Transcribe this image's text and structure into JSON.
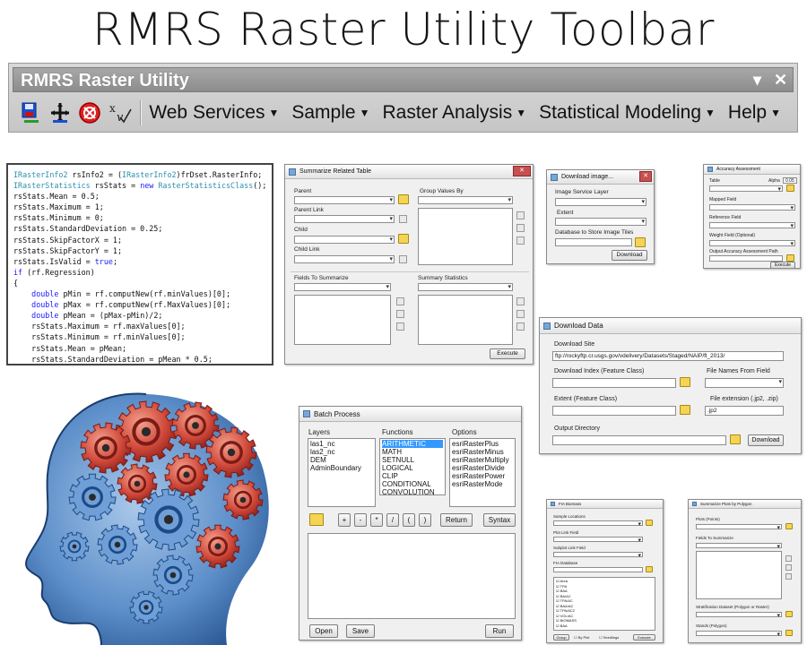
{
  "slide": {
    "title": "RMRS Raster Utility Toolbar"
  },
  "toolbar": {
    "title": "RMRS Raster Utility",
    "controls": {
      "dropdown": "▾",
      "close": "✕"
    },
    "icons": [
      "save-raster-icon",
      "add-data-icon",
      "target-icon",
      "function-icon"
    ],
    "menus": [
      {
        "label": "Web Services"
      },
      {
        "label": "Sample"
      },
      {
        "label": "Raster Analysis"
      },
      {
        "label": "Statistical Modeling"
      },
      {
        "label": "Help"
      }
    ]
  },
  "code": {
    "lines": [
      "IRasterInfo2 rsInfo2 = (IRasterInfo2)frDset.RasterInfo;",
      "IRasterStatistics rsStats = new RasterStatisticsClass();",
      "rsStats.Mean = 0.5;",
      "rsStats.Maximum = 1;",
      "rsStats.Minimum = 0;",
      "rsStats.StandardDeviation = 0.25;",
      "rsStats.SkipFactorX = 1;",
      "rsStats.SkipFactorY = 1;",
      "rsStats.IsValid = true;",
      "if (rf.Regression)",
      "{",
      "    double pMin = rf.computNew(rf.minValues)[0];",
      "    double pMax = rf.computNew(rf.MaxValues)[0];",
      "    double pMean = (pMax-pMin)/2;",
      "    rsStats.Maximum = rf.maxValues[0];",
      "    rsStats.Minimum = rf.minValues[0];",
      "    rsStats.Mean = pMean;",
      "    rsStats.StandardDeviation = pMean * 0.5;",
      "}"
    ]
  },
  "summarize": {
    "title": "Summarize Related Table",
    "parent": "Parent",
    "parent_link": "Parent Link",
    "child": "Child",
    "child_link": "Child Link",
    "group_values_by": "Group Values By",
    "fields_to_summarize": "Fields To Summarize",
    "summary_statistics": "Summary Statistics",
    "execute": "Execute"
  },
  "download_image": {
    "title": "Download image...",
    "image_service_layer": "Image Service Layer",
    "extent": "Extent",
    "database": "Database to Store Image Tiles",
    "download": "Download"
  },
  "accuracy": {
    "title": "Accuracy Assessment",
    "table": "Table",
    "alpha": "Alpha",
    "alpha_value": "0.05",
    "mapped_field": "Mapped Field",
    "reference_field": "Reference Field",
    "weight_field": "Weight Field (Optional)",
    "output_path": "Output Accuracy Assessment Path",
    "execute": "Execute"
  },
  "download_data": {
    "title": "Download Data",
    "download_site": "Download Site",
    "site_url": "ftp://rockyftp.cr.usgs.gov/vdelivery/Datasets/Staged/NAIP/fl_2013/",
    "download_index": "Download Index (Feature Class)",
    "file_names_from_field": "File Names From Field",
    "extent": "Extent (Feature Class)",
    "file_extension": "File extension (.jp2, .zip)",
    "extension_value": ".jp2",
    "output_directory": "Output Directory",
    "download": "Download"
  },
  "batch": {
    "title": "Batch Process",
    "layers_label": "Layers",
    "functions_label": "Functions",
    "options_label": "Options",
    "layers": [
      "las1_nc",
      "las2_nc",
      "DEM",
      "AdminBoundary"
    ],
    "functions": [
      "ARITHMETIC",
      "MATH",
      "SETNULL",
      "LOGICAL",
      "CLIP",
      "CONDITIONAL",
      "CONVOLUTION",
      "FOCAL"
    ],
    "options": [
      "esriRasterPlus",
      "esriRasterMinus",
      "esriRasterMultiply",
      "esriRasterDivide",
      "esriRasterPower",
      "esriRasterMode"
    ],
    "operators": [
      "+",
      "-",
      "*",
      "/",
      "(",
      ")"
    ],
    "return": "Return",
    "syntax": "Syntax",
    "open": "Open",
    "save": "Save",
    "run": "Run"
  },
  "fia": {
    "title": "FIA Biomass",
    "sample_locations": "Sample Locations",
    "plot_link_field": "Plot Link Field",
    "subplot_link_field": "Subplot Link Field",
    "fia_database": "FIA Database",
    "items": [
      "Area",
      "TPA",
      "BAA",
      "BA/AC",
      "TPA/AC",
      "BAA/AC",
      "TPA/AC2",
      "VOL/AC",
      "BIOMASS",
      "BAA"
    ],
    "group": "Group",
    "by_plot": "By Plot",
    "seedlings": "Seedlings",
    "execute": "Execute"
  },
  "polygon": {
    "title": "Summarize Plots by Polygon",
    "plots": "Plots (Points)",
    "fields_to_summarize": "Fields To Summarize",
    "stratification": "Stratification Dataset (Polygon or Raster)",
    "stands": "Stands (Polygon)"
  },
  "colors": {
    "accent": "#3399ff",
    "folder": "#f6d453",
    "close": "#c75050"
  }
}
